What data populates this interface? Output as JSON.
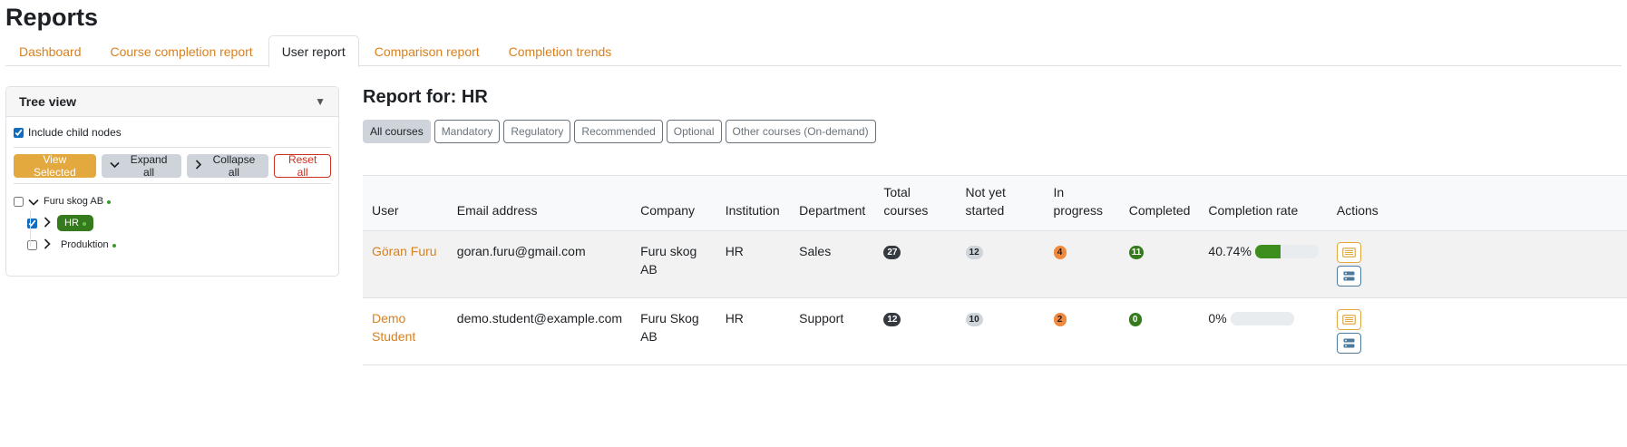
{
  "page": {
    "title": "Reports"
  },
  "tabs": [
    {
      "label": "Dashboard",
      "active": false
    },
    {
      "label": "Course completion report",
      "active": false
    },
    {
      "label": "User report",
      "active": true
    },
    {
      "label": "Comparison report",
      "active": false
    },
    {
      "label": "Completion trends",
      "active": false
    }
  ],
  "tree": {
    "title": "Tree view",
    "toggle_icon": "triangle-down-icon",
    "include_child_nodes": {
      "label": "Include child nodes",
      "checked": true
    },
    "buttons": {
      "view_selected": "View Selected",
      "expand_all": "Expand all",
      "collapse_all": "Collapse all",
      "reset_all": "Reset all"
    },
    "nodes": [
      {
        "label": "Furu skog AB",
        "checked": false,
        "expanded": true,
        "selected": false
      },
      {
        "label": "HR",
        "checked": true,
        "expanded": false,
        "selected": true
      },
      {
        "label": "Produktion",
        "checked": false,
        "expanded": false,
        "selected": false
      }
    ]
  },
  "report": {
    "title": "Report for: HR",
    "filters": [
      {
        "label": "All courses",
        "active": true
      },
      {
        "label": "Mandatory",
        "active": false
      },
      {
        "label": "Regulatory",
        "active": false
      },
      {
        "label": "Recommended",
        "active": false
      },
      {
        "label": "Optional",
        "active": false
      },
      {
        "label": "Other courses (On-demand)",
        "active": false
      }
    ],
    "columns": {
      "user": "User",
      "email": "Email address",
      "company": "Company",
      "institution": "Institution",
      "department": "Department",
      "total_line1": "Total",
      "total_line2": "courses",
      "notstarted_line1": "Not yet",
      "notstarted_line2": "started",
      "inprogress_line1": "In",
      "inprogress_line2": "progress",
      "completed": "Completed",
      "completion_rate": "Completion rate",
      "actions": "Actions"
    },
    "rows": [
      {
        "user": "Göran Furu",
        "email": "goran.furu@gmail.com",
        "company": "Furu skog AB",
        "institution": "HR",
        "department": "Sales",
        "total": "27",
        "not_started": "12",
        "in_progress": "4",
        "completed": "11",
        "completion_rate": "40.74%",
        "completion_fraction": 0.4074
      },
      {
        "user": "Demo Student",
        "email": "demo.student@example.com",
        "company": "Furu Skog AB",
        "institution": "HR",
        "department": "Support",
        "total": "12",
        "not_started": "10",
        "in_progress": "2",
        "completed": "0",
        "completion_rate": "0%",
        "completion_fraction": 0
      }
    ]
  },
  "colors": {
    "accent": "#d9801e",
    "primary_button": "#e3a93f",
    "selected_node": "#357a1c",
    "progress_fill": "#3d8f1d",
    "danger": "#ca3120"
  }
}
